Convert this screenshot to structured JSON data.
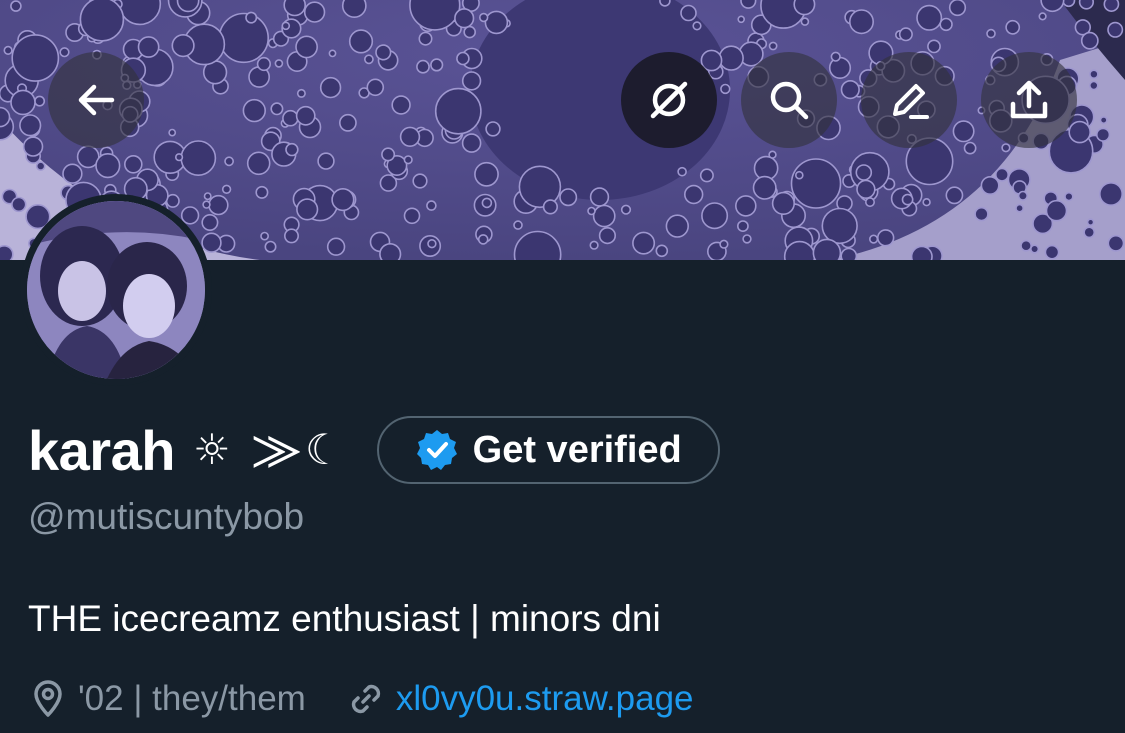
{
  "header": {
    "back_icon": "arrow-left-icon",
    "actions": [
      {
        "name": "unfollow-toggle",
        "icon": "slashed-circle-icon"
      },
      {
        "name": "search",
        "icon": "search-icon"
      },
      {
        "name": "edit",
        "icon": "pencil-icon"
      },
      {
        "name": "share",
        "icon": "share-upload-icon"
      }
    ]
  },
  "profile": {
    "display_name": "karah",
    "name_glyphs": "☼ ⨠☾",
    "verify_button": {
      "label": "Get verified",
      "icon": "verified-badge-icon",
      "badge_color": "#1d9bf0"
    },
    "handle": "@mutiscuntybob",
    "bio": "THE icecreamz enthusiast | minors dni",
    "location": "'02 | they/them",
    "link": "xl0vy0u.straw.page",
    "location_icon": "location-pin-icon",
    "link_icon": "link-icon"
  },
  "colors": {
    "background": "#15202b",
    "secondary_text": "#8b98a5",
    "link": "#1d9bf0",
    "banner_tint": "#4a4580"
  }
}
